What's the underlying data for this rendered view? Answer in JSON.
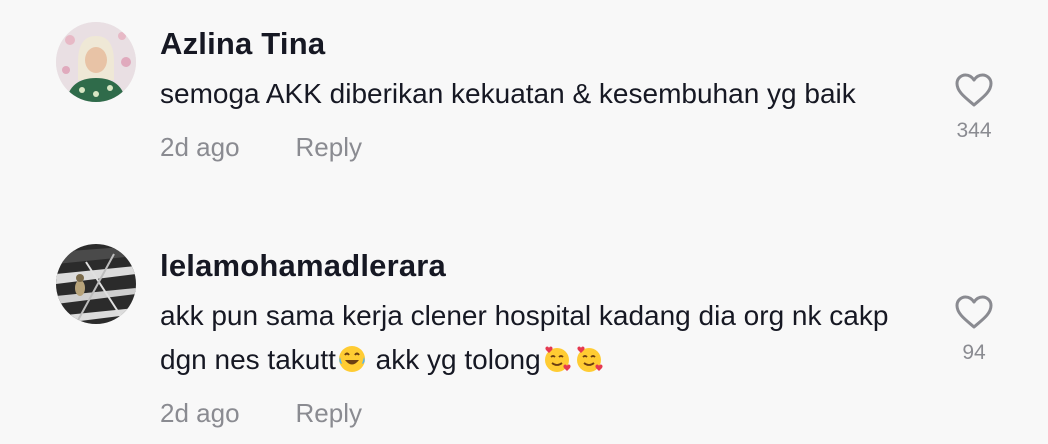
{
  "comments": [
    {
      "username": "Azlina Tina",
      "text": "semoga AKK diberikan kekuatan & kesembuhan yg baik",
      "time": "2d ago",
      "reply_label": "Reply",
      "likes": "344",
      "avatar_icon": "profile-photo"
    },
    {
      "username": "lelamohamadlerara",
      "text_part1": "akk pun sama kerja clener hospital kadang dia org nk cakp dgn nes takutt",
      "text_part2": " akk yg tolong",
      "emoji1": "face-with-tears-of-joy-emoji",
      "emoji2": "smiling-face-with-hearts-emoji",
      "time": "2d ago",
      "reply_label": "Reply",
      "likes": "94",
      "avatar_icon": "profile-photo"
    }
  ],
  "colors": {
    "background": "#f8f8f8",
    "text": "#161823",
    "muted": "#8a8b91"
  }
}
